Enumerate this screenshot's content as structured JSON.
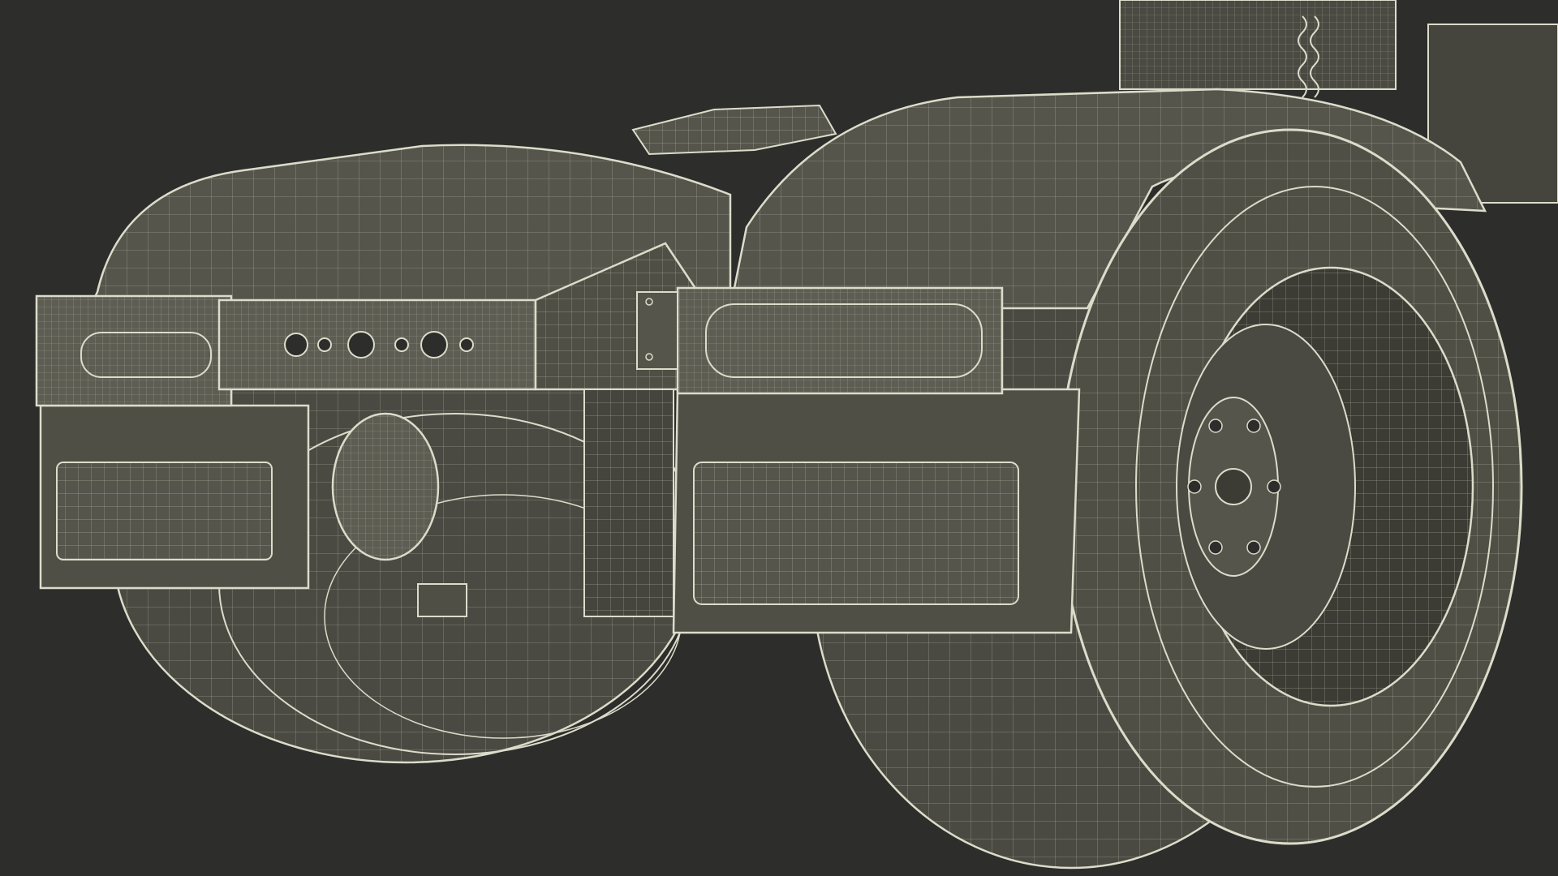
{
  "scene": {
    "subject": "truck-rear-chassis-wireframe",
    "render_style": "wireframe-on-shaded",
    "colors": {
      "background": "#2d2d2b",
      "surface": "#4f4f46",
      "surface_light": "#5d5d53",
      "surface_dark": "#3c3c35",
      "wire": "#dcdccb",
      "wire_dim": "#a9a99a"
    }
  }
}
